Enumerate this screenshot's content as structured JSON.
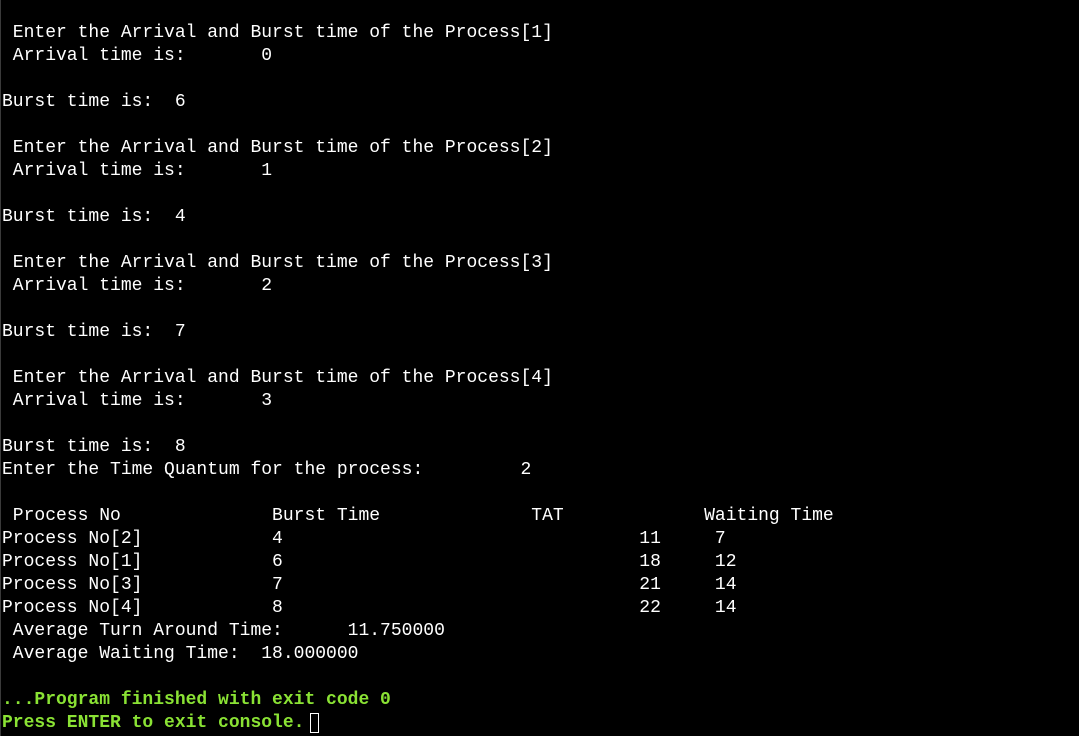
{
  "console": {
    "lines": [
      " Enter the Arrival and Burst time of the Process[1]",
      " Arrival time is:       0",
      "",
      "Burst time is:  6",
      "",
      " Enter the Arrival and Burst time of the Process[2]",
      " Arrival time is:       1",
      "",
      "Burst time is:  4",
      "",
      " Enter the Arrival and Burst time of the Process[3]",
      " Arrival time is:       2",
      "",
      "Burst time is:  7",
      "",
      " Enter the Arrival and Burst time of the Process[4]",
      " Arrival time is:       3",
      "",
      "Burst time is:  8",
      "Enter the Time Quantum for the process:         2",
      "",
      " Process No              Burst Time              TAT             Waiting Time",
      "Process No[2]            4                                 11     7",
      "Process No[1]            6                                 18     12",
      "Process No[3]            7                                 21     14",
      "Process No[4]            8                                 22     14",
      " Average Turn Around Time:      11.750000",
      " Average Waiting Time:  18.000000",
      "",
      "...Program finished with exit code 0",
      "Press ENTER to exit console."
    ]
  },
  "colors": {
    "background": "#000000",
    "text": "#ffffff",
    "finished_text": "#8ae234"
  }
}
